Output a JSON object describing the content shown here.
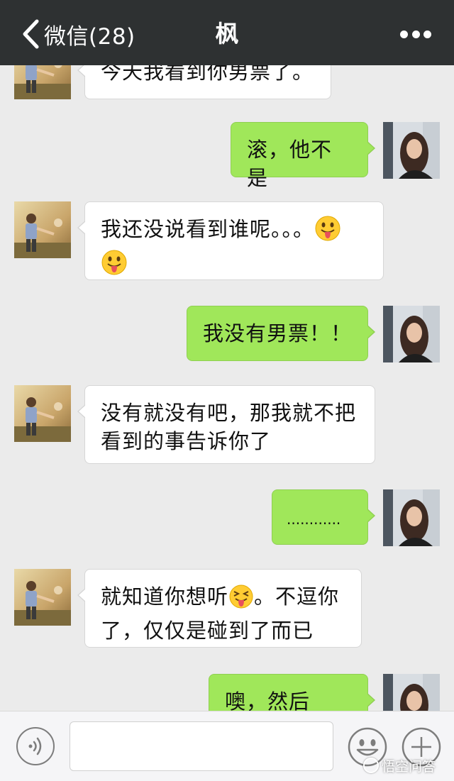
{
  "header": {
    "back_label": "微信(28)",
    "title": "枫"
  },
  "icons": {
    "back": "chevron-left-icon",
    "more": "more-dots-icon",
    "voice": "voice-icon",
    "emoji": "smiley-face-icon",
    "plus": "plus-icon"
  },
  "colors": {
    "header_bg": "#2e3132",
    "chat_bg": "#ebebeb",
    "incoming_bubble": "#ffffff",
    "outgoing_bubble": "#a0e75a"
  },
  "messages": [
    {
      "direction": "in",
      "text": "今天我看到你男票了。"
    },
    {
      "direction": "out",
      "text": "滚，他不是"
    },
    {
      "direction": "in",
      "text_a": "我还没说看到谁呢。。。",
      "emoji_1": "tongue-out-emoji",
      "emoji_2": "tongue-out-emoji"
    },
    {
      "direction": "out",
      "text": "我没有男票！！"
    },
    {
      "direction": "in",
      "line1": "没有就没有吧，那我就不把",
      "line2": "看到的事告诉你了"
    },
    {
      "direction": "out",
      "text": "............"
    },
    {
      "direction": "in",
      "text_a": "就知道你想听",
      "emoji_1": "squinting-tongue-emoji",
      "text_b": "。不逗你",
      "line2": "了，仅仅是碰到了而已"
    },
    {
      "direction": "out",
      "text": "噢，然后呢？"
    }
  ],
  "input": {
    "value": "",
    "placeholder": ""
  },
  "watermark": {
    "text": "悟空问答"
  }
}
